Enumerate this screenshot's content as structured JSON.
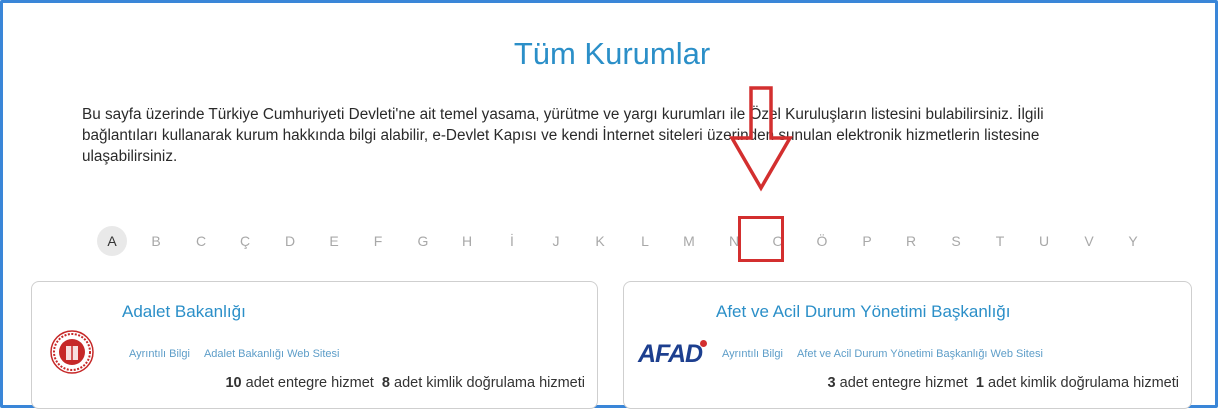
{
  "page": {
    "title": "Tüm Kurumlar",
    "description": "Bu sayfa üzerinde Türkiye Cumhuriyeti Devleti'ne ait temel yasama, yürütme ve yargı kurumları ile Özel Kuruluşların listesini bulabilirsiniz. İlgili bağlantıları kullanarak kurum hakkında bilgi alabilir, e-Devlet Kapısı ve kendi İnternet siteleri üzerinden sunulan elektronik hizmetlerin listesine ulaşabilirsiniz."
  },
  "letters": [
    "A",
    "B",
    "C",
    "Ç",
    "D",
    "E",
    "F",
    "G",
    "H",
    "İ",
    "J",
    "K",
    "L",
    "M",
    "N",
    "O",
    "Ö",
    "P",
    "R",
    "S",
    "T",
    "U",
    "V",
    "Y"
  ],
  "active_letter": "A",
  "highlighted_letter": "O",
  "colors": {
    "accent": "#2b8fc8",
    "annotation": "#d32f2f",
    "frame": "#3a86d8"
  },
  "cards": [
    {
      "title": "Adalet Bakanlığı",
      "logo": "ministry-of-justice-seal-icon",
      "link_info": "Ayrıntılı Bilgi",
      "link_site": "Adalet Bakanlığı Web Sitesi",
      "integrated_count": "10",
      "integrated_label": "adet entegre hizmet",
      "auth_count": "8",
      "auth_label": "adet kimlik doğrulama hizmeti"
    },
    {
      "title": "Afet ve Acil Durum Yönetimi Başkanlığı",
      "logo": "afad-logo",
      "logo_text": "AFAD",
      "link_info": "Ayrıntılı Bilgi",
      "link_site": "Afet ve Acil Durum Yönetimi Başkanlığı Web Sitesi",
      "integrated_count": "3",
      "integrated_label": "adet entegre hizmet",
      "auth_count": "1",
      "auth_label": "adet kimlik doğrulama hizmeti"
    }
  ]
}
